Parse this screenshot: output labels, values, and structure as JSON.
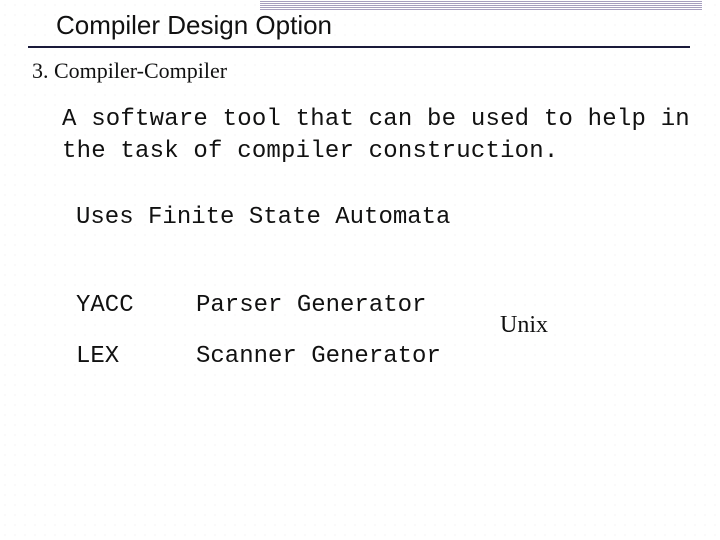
{
  "title": "Compiler Design Option",
  "section_number": "3.",
  "section_name": "Compiler-Compiler",
  "definition": "A software tool that can be used to help in the task of compiler construction.",
  "note": "Uses Finite State Automata",
  "tools": [
    {
      "name": "YACC",
      "desc": "Parser Generator"
    },
    {
      "name": "LEX",
      "desc": "Scanner Generator"
    }
  ],
  "platform": "Unix"
}
